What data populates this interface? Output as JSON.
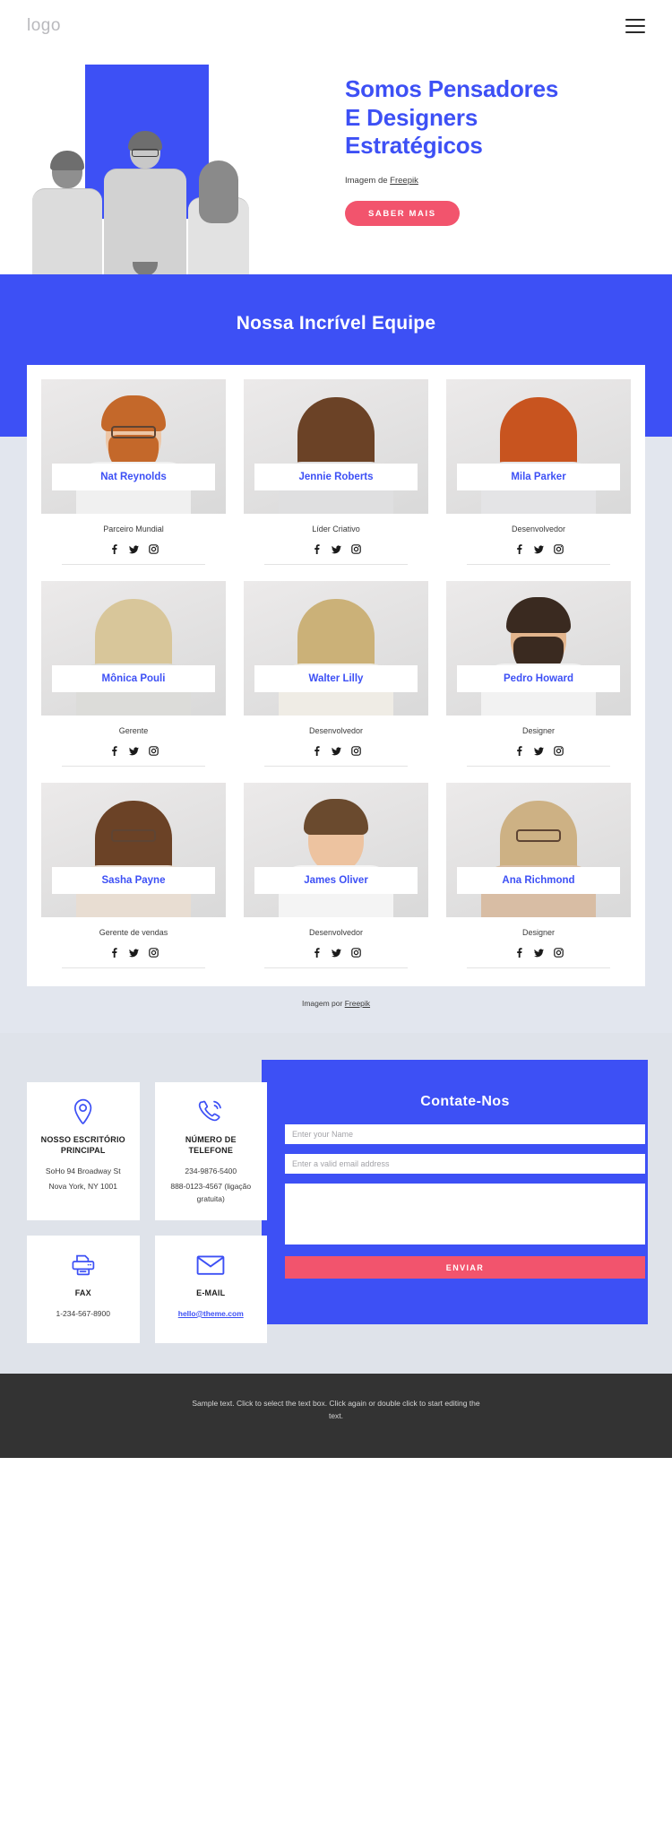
{
  "header": {
    "logo": "logo",
    "menu_icon": "hamburger-menu-icon"
  },
  "hero": {
    "title": "Somos Pensadores E Designers Estratégicos",
    "credit_prefix": "Imagem de ",
    "credit_link": "Freepik",
    "cta_label": "SABER MAIS",
    "accent_blue": "#3d50f5",
    "accent_pink": "#f2546d"
  },
  "team": {
    "heading": "Nossa Incrível Equipe",
    "credit_prefix": "Imagem por ",
    "credit_link": "Freepik",
    "members": [
      {
        "name": "Nat Reynolds",
        "role": "Parceiro Mundial"
      },
      {
        "name": "Jennie Roberts",
        "role": "Líder Criativo"
      },
      {
        "name": "Mila Parker",
        "role": "Desenvolvedor"
      },
      {
        "name": "Mônica Pouli",
        "role": "Gerente"
      },
      {
        "name": "Walter Lilly",
        "role": "Desenvolvedor"
      },
      {
        "name": "Pedro Howard",
        "role": "Designer"
      },
      {
        "name": "Sasha Payne",
        "role": "Gerente de vendas"
      },
      {
        "name": "James Oliver",
        "role": "Desenvolvedor"
      },
      {
        "name": "Ana Richmond",
        "role": "Designer"
      }
    ],
    "social": [
      "facebook-icon",
      "twitter-icon",
      "instagram-icon"
    ]
  },
  "contact": {
    "cards": [
      {
        "icon": "location-pin-icon",
        "title": "NOSSO ESCRITÓRIO PRINCIPAL",
        "lines": [
          "SoHo 94 Broadway St",
          "Nova York, NY 1001"
        ]
      },
      {
        "icon": "phone-icon",
        "title": "NÚMERO DE TELEFONE",
        "lines": [
          "234-9876-5400",
          "888-0123-4567 (ligação gratuita)"
        ]
      },
      {
        "icon": "fax-printer-icon",
        "title": "FAX",
        "lines": [
          "1-234-567-8900"
        ]
      },
      {
        "icon": "envelope-icon",
        "title": "E-MAIL",
        "lines": [],
        "link": "hello@theme.com"
      }
    ],
    "form": {
      "title": "Contate-Nos",
      "name_placeholder": "Enter your Name",
      "email_placeholder": "Enter a valid email address",
      "message_placeholder": "",
      "submit_label": "ENVIAR"
    }
  },
  "footer": {
    "text": "Sample text. Click to select the text box. Click again or double click to start editing the text."
  }
}
